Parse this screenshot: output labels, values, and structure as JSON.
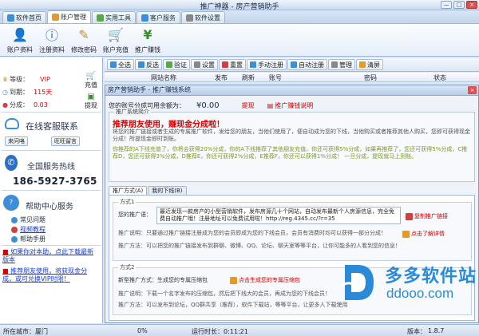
{
  "window": {
    "title": "推广神器 - 房产营销助手",
    "controls": [
      "—",
      "□",
      "×"
    ]
  },
  "tabs": [
    {
      "label": "软件首页",
      "color": "#3c8ed8"
    },
    {
      "label": "账户管理",
      "color": "#e29b2b"
    },
    {
      "label": "实用工具",
      "color": "#5aa844"
    },
    {
      "label": "客户服务",
      "color": "#3c8ed8"
    },
    {
      "label": "软件设置",
      "color": "#888888"
    }
  ],
  "ribbon": [
    {
      "label": "账户资料",
      "icon": "user-icon",
      "glyph": "👤",
      "color": "#2f6fbf"
    },
    {
      "label": "注册资料",
      "icon": "info-icon",
      "glyph": "ⓘ",
      "color": "#1f5fb0"
    },
    {
      "label": "修改密码",
      "icon": "pencil-icon",
      "glyph": "✎",
      "color": "#c79020"
    },
    {
      "label": "账户充值",
      "icon": "cart-icon",
      "glyph": "🛒",
      "color": "#4a9a2a"
    },
    {
      "label": "推广赚钱",
      "icon": "money-icon",
      "glyph": "¥",
      "color": "#3a8a30"
    }
  ],
  "account": {
    "level_label": "等级：",
    "level_value": "VIP",
    "expire_label": "到期：",
    "expire_value": "115天",
    "points_label": "分成：",
    "points_value": "0.03",
    "recharge_label": "充值",
    "withdraw_label": "提现"
  },
  "support": {
    "online_title": "在线客服联系",
    "qq_button": "来问咯",
    "wangwang_button": "旺旺留言",
    "hotline_title": "全国服务热线",
    "phone": "186-5927-3765",
    "help_title": "帮助中心服务",
    "help_links": [
      {
        "label": "常见问题",
        "color": "#3c8ed8"
      },
      {
        "label": "视频教程",
        "color": "#d04040"
      },
      {
        "label": "帮助手册",
        "color": "#3c8ed8"
      }
    ],
    "promos": [
      "如果你对本助，点此下载最新版本",
      "推荐朋友使用，将获现金分成，或可兑换VIP时限！"
    ]
  },
  "main_toolbar": [
    {
      "label": "全选",
      "color": "#3c8ed8"
    },
    {
      "label": "反选",
      "color": "#3c8ed8"
    },
    {
      "label": "验证",
      "color": "#5aa844"
    },
    {
      "label": "设置",
      "color": "#888888"
    },
    {
      "label": "重置",
      "color": "#d04040"
    },
    {
      "label": "手动注册",
      "color": "#3c8ed8"
    },
    {
      "label": "自动注册",
      "color": "#3c8ed8"
    },
    {
      "label": "管理",
      "color": "#888888"
    },
    {
      "label": "清屏",
      "color": "#e29b2b"
    }
  ],
  "table_columns": [
    "网站名称",
    "发布",
    "刷新",
    "账号",
    "密码",
    "状态"
  ],
  "dialog": {
    "title": "房产营销助手 - 推广赚钱系统",
    "close": "×",
    "balance_label": "您的账号分成可用余额为：",
    "balance_value": "¥0.00",
    "withdraw_link": "提现",
    "promo_note": "推广赚钱说明",
    "sys_legend": "推广系统简介",
    "headline": "推荐朋友使用，赚现金分成啦！",
    "description": "将您的推广链接或者生成的专属推广软件，发给您的朋友，当他们使用了，便自动成为您的下线，当他购买或者推荐其他人购买，您即可获得现金分成！所提现金即时到账。",
    "hint": "你推荐的A下线充值了，你将会获得20%分成，你的A下线推荐了其他朋友充值，你还可获得5%分成，如果再推荐了，您还可获得5%分成，C推荐D，您还可获得3%分成，D推荐E，你还可获得2%分成，E推荐F，你还可以获得1%分成！ 一旦分成，提现就马上到账。",
    "subtabs": [
      "推广方式(A)",
      "我的下线(B)"
    ],
    "method1": {
      "legend": "方式1",
      "link_label": "您的推广语：",
      "link_text": "最近发现一款房产的小型营销软件，发布房源几十个网站，自动发布最新个人房源信息，完全免费自动推广哦！注册地址可以免费试用啦！http://reg.4345.cc/?r=35",
      "copy_action": "复制推广链接",
      "note1_label": "推广说明：",
      "note1": "只要通过推广链接注册成为您的会员即成为您的下线会员，会员有消费时均可以获得一部分分成！",
      "note1_action": "点击了解详情",
      "note2_label": "推广方法：",
      "note2": "可以把您的推广链接发布到群聊、微博、QQ、论坛、聊天室等等平台，让你可能多的人看到您的信息！"
    },
    "method2": {
      "legend": "方式2",
      "label": "新型推广方式：生成您的专属压缩包",
      "action": "点击生成您的专属压缩包",
      "note1_label": "推广说明：",
      "note1": "下载一个名字发布的压缩包，然后把下线大的会员，再成为您的下线会员！",
      "note2_label": "推广方法：",
      "note2": "可以发布到论坛，QQ群共享（推荐），软件下载站，等等平台，让更多人下载使用"
    }
  },
  "statusbar": {
    "location": "所在城市：厦门",
    "progress": "0%",
    "runtime": "运行时长：0:11:21",
    "version_label": "版本：",
    "version": "1.8.7"
  },
  "watermark": {
    "name": "多多软件站",
    "url": "ddooo.com"
  }
}
